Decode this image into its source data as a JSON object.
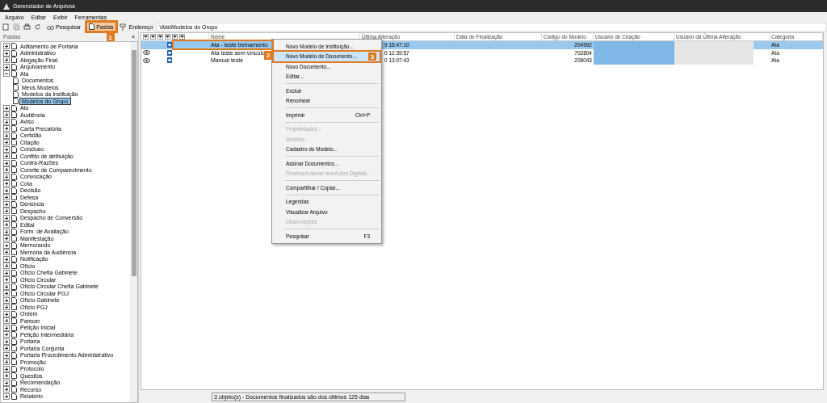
{
  "window": {
    "title": "Gerenciador de Arquivos"
  },
  "menu": [
    "Arquivo",
    "Editar",
    "Exibir",
    "Ferramentas"
  ],
  "toolbar": {
    "search": "Pesquisar",
    "folders": {
      "label": "Pastas",
      "selected": true,
      "callout": "1"
    },
    "address_label": "Endereço",
    "address": "\\Ata\\Modelos do Grupo"
  },
  "folders_panel": {
    "title": "Pastas",
    "close": "×"
  },
  "tree": [
    {
      "label": "Aditamento de Portaria",
      "expanded": false,
      "selected": false
    },
    {
      "label": "Administrativo",
      "expanded": false,
      "selected": false
    },
    {
      "label": "Alegação Final",
      "expanded": false,
      "selected": false
    },
    {
      "label": "Arquivamento",
      "expanded": false,
      "selected": false
    },
    {
      "label": "Ata",
      "expanded": true,
      "selected": false,
      "children": [
        {
          "label": "Documentos",
          "selected": false
        },
        {
          "label": "Meus Modelos",
          "selected": false
        },
        {
          "label": "Modelos da Instituição",
          "selected": false
        },
        {
          "label": "Modelos do Grupo",
          "selected": true
        }
      ]
    },
    {
      "label": "Ato",
      "expanded": false,
      "selected": false
    },
    {
      "label": "Audiência",
      "expanded": false,
      "selected": false
    },
    {
      "label": "Aviso",
      "expanded": false,
      "selected": false
    },
    {
      "label": "Carta Precatória",
      "expanded": false,
      "selected": false
    },
    {
      "label": "Certidão",
      "expanded": false,
      "selected": false
    },
    {
      "label": "Citação",
      "expanded": false,
      "selected": false
    },
    {
      "label": "Concluso",
      "expanded": false,
      "selected": false
    },
    {
      "label": "Conflito de atribuição",
      "expanded": false,
      "selected": false
    },
    {
      "label": "Contra-Razões",
      "expanded": false,
      "selected": false
    },
    {
      "label": "Convite de Comparecimento",
      "expanded": false,
      "selected": false
    },
    {
      "label": "Convocação",
      "expanded": false,
      "selected": false
    },
    {
      "label": "Cota",
      "expanded": false,
      "selected": false
    },
    {
      "label": "Decisão",
      "expanded": false,
      "selected": false
    },
    {
      "label": "Defesa",
      "expanded": false,
      "selected": false
    },
    {
      "label": "Denúncia",
      "expanded": false,
      "selected": false
    },
    {
      "label": "Despacho",
      "expanded": false,
      "selected": false
    },
    {
      "label": "Despacho de Conversão",
      "expanded": false,
      "selected": false
    },
    {
      "label": "Edital",
      "expanded": false,
      "selected": false
    },
    {
      "label": "Form. de Avaliação",
      "expanded": false,
      "selected": false
    },
    {
      "label": "Manifestação",
      "expanded": false,
      "selected": false
    },
    {
      "label": "Memorando",
      "expanded": false,
      "selected": false
    },
    {
      "label": "Memória da Audiência",
      "expanded": false,
      "selected": false
    },
    {
      "label": "Notificação",
      "expanded": false,
      "selected": false
    },
    {
      "label": "Ofício",
      "expanded": false,
      "selected": false
    },
    {
      "label": "Ofício Chefia Gabinete",
      "expanded": false,
      "selected": false
    },
    {
      "label": "Ofício Circular",
      "expanded": false,
      "selected": false
    },
    {
      "label": "Ofício Circular Chefia Gabinete",
      "expanded": false,
      "selected": false
    },
    {
      "label": "Ofício Circular PGJ",
      "expanded": false,
      "selected": false
    },
    {
      "label": "Ofício Gabinete",
      "expanded": false,
      "selected": false
    },
    {
      "label": "Ofício PGJ",
      "expanded": false,
      "selected": false
    },
    {
      "label": "Ordem",
      "expanded": false,
      "selected": false
    },
    {
      "label": "Parecer",
      "expanded": false,
      "selected": false
    },
    {
      "label": "Petição Inicial",
      "expanded": false,
      "selected": false
    },
    {
      "label": "Petição Intermediária",
      "expanded": false,
      "selected": false
    },
    {
      "label": "Portaria",
      "expanded": false,
      "selected": false
    },
    {
      "label": "Portaria Conjunta",
      "expanded": false,
      "selected": false
    },
    {
      "label": "Portaria Procedimento Administrativo",
      "expanded": false,
      "selected": false
    },
    {
      "label": "Promoção",
      "expanded": false,
      "selected": false
    },
    {
      "label": "Protocolo",
      "expanded": false,
      "selected": false
    },
    {
      "label": "Quesitos",
      "expanded": false,
      "selected": false
    },
    {
      "label": "Recomendação",
      "expanded": false,
      "selected": false
    },
    {
      "label": "Recurso",
      "expanded": false,
      "selected": false
    },
    {
      "label": "Relatório",
      "expanded": false,
      "selected": false
    }
  ],
  "table": {
    "columns": [
      "Nome",
      "Última Alteração",
      "Data de Finalização",
      "Código do Modelo",
      "Usuário de Criação",
      "Usuário da Última Alteração",
      "Categoria"
    ],
    "rows": [
      {
        "selected": true,
        "viewed": false,
        "callout": "2",
        "name": "Ata - teste treinamento",
        "modified": "9 15:47:10",
        "code": "204992",
        "category": "Ata"
      },
      {
        "selected": false,
        "viewed": true,
        "name": "Ata teste sem vínculo",
        "modified": "0 12:39:57",
        "code": "702804",
        "category": "Ata"
      },
      {
        "selected": false,
        "viewed": true,
        "name": "Manual teste",
        "modified": "0 13:07:43",
        "code": "208043",
        "category": "Ata"
      }
    ]
  },
  "context_menu": [
    {
      "kind": "item",
      "label": "Novo Modelo de Instituição...",
      "disabled": false,
      "selected": false
    },
    {
      "kind": "item",
      "label": "Novo Modelo de Documento...",
      "disabled": false,
      "selected": true,
      "callout": "3"
    },
    {
      "kind": "item",
      "label": "Novo Documento...",
      "disabled": false,
      "selected": false
    },
    {
      "kind": "item",
      "label": "Editar...",
      "disabled": false,
      "selected": false
    },
    {
      "kind": "separator"
    },
    {
      "kind": "item",
      "label": "Excluir",
      "disabled": false,
      "selected": false
    },
    {
      "kind": "item",
      "label": "Renomear",
      "disabled": false,
      "selected": false
    },
    {
      "kind": "separator"
    },
    {
      "kind": "item",
      "label": "Imprimir",
      "shortcut": "Ctrl+P",
      "disabled": false,
      "selected": false
    },
    {
      "kind": "separator"
    },
    {
      "kind": "item",
      "label": "Propriedades...",
      "disabled": true,
      "selected": false
    },
    {
      "kind": "item",
      "label": "Versões...",
      "disabled": true,
      "selected": false
    },
    {
      "kind": "item",
      "label": "Cadastro do Modelo...",
      "disabled": false,
      "selected": false
    },
    {
      "kind": "separator"
    },
    {
      "kind": "item",
      "label": "Assinar Documentos...",
      "disabled": false,
      "selected": false
    },
    {
      "kind": "item",
      "label": "Finalizar/Liberar nos Autos Digitais...",
      "disabled": true,
      "selected": false
    },
    {
      "kind": "separator"
    },
    {
      "kind": "item",
      "label": "Compartilhar / Copiar...",
      "disabled": false,
      "selected": false
    },
    {
      "kind": "separator"
    },
    {
      "kind": "item",
      "label": "Legendas",
      "disabled": false,
      "selected": false
    },
    {
      "kind": "item",
      "label": "Visualizar Arquivo",
      "disabled": false,
      "selected": false
    },
    {
      "kind": "item",
      "label": "Observações",
      "disabled": true,
      "selected": false
    },
    {
      "kind": "separator"
    },
    {
      "kind": "item",
      "label": "Pesquisar",
      "shortcut": "F3",
      "disabled": false,
      "selected": false
    }
  ],
  "status_bar": "3 objeto(s) - Documentos finalizados são dos últimos 125 dias"
}
